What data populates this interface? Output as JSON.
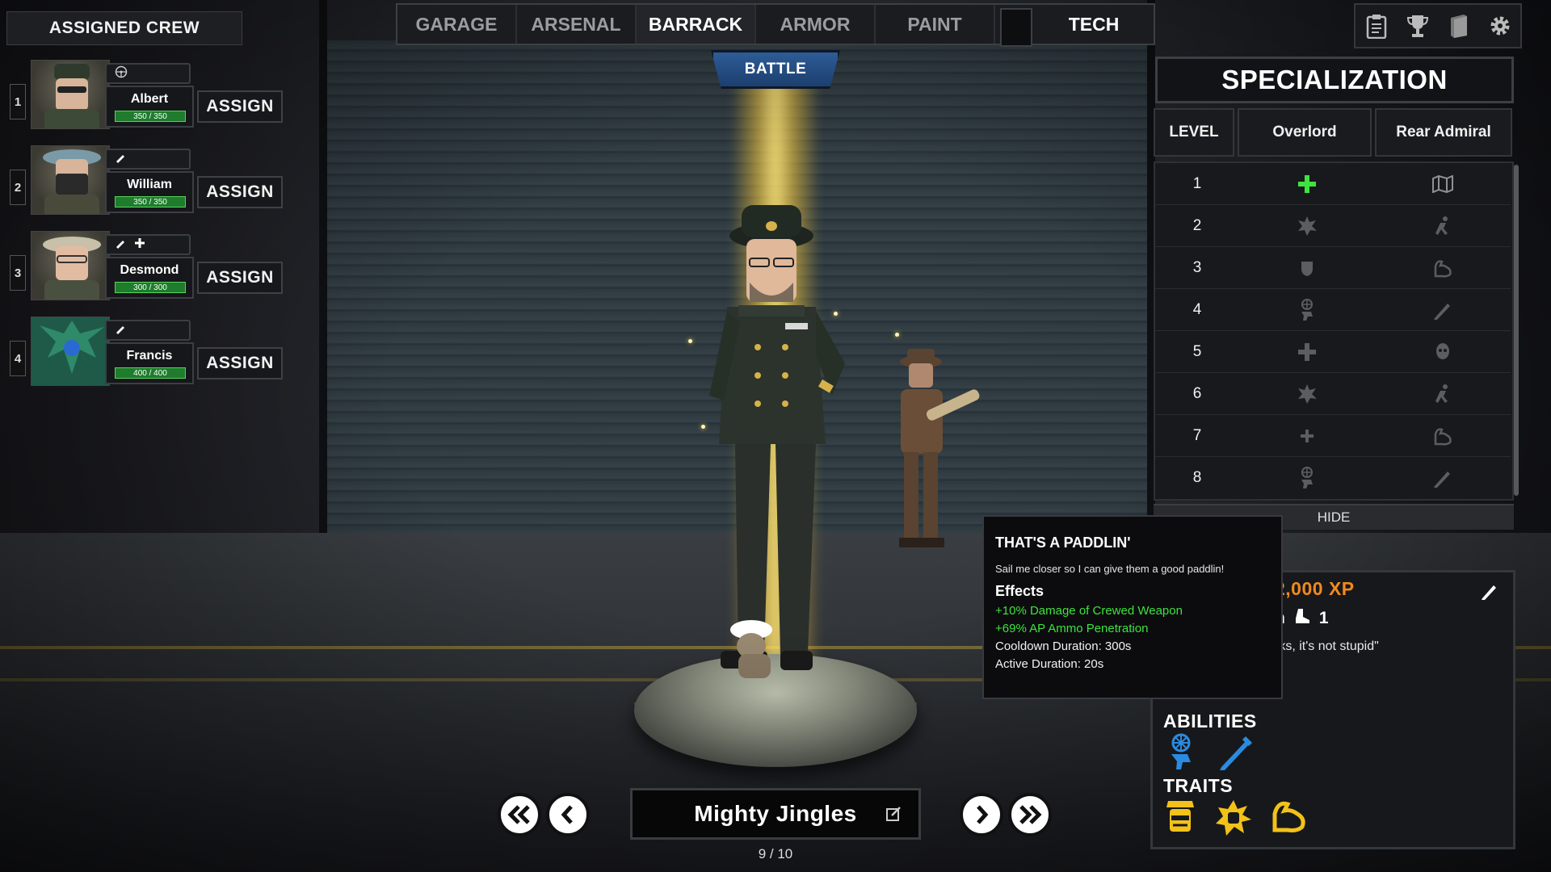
{
  "crew": {
    "header": "ASSIGNED CREW",
    "members": [
      {
        "num": "1",
        "name": "Albert",
        "hp": "350 / 350",
        "assign": "ASSIGN",
        "badges": [
          "steering-wheel-icon"
        ]
      },
      {
        "num": "2",
        "name": "William",
        "hp": "350 / 350",
        "assign": "ASSIGN",
        "badges": [
          "pencil-icon"
        ]
      },
      {
        "num": "3",
        "name": "Desmond",
        "hp": "300 / 300",
        "assign": "ASSIGN",
        "badges": [
          "pencil-icon",
          "plus-icon"
        ]
      },
      {
        "num": "4",
        "name": "Francis",
        "hp": "400 / 400",
        "assign": "ASSIGN",
        "badges": [
          "pencil-icon"
        ]
      }
    ]
  },
  "nav": {
    "tabs": [
      "GARAGE",
      "ARSENAL",
      "BARRACK",
      "ARMOR",
      "PAINT",
      "TECH"
    ],
    "active": "BARRACK",
    "battle": "BATTLE"
  },
  "top_icons": [
    "clipboard-icon",
    "trophy-icon",
    "book-icon",
    "gear-icon"
  ],
  "specialization": {
    "title": "SPECIALIZATION",
    "columns": [
      "LEVEL",
      "Overlord",
      "Rear Admiral"
    ],
    "rows": [
      {
        "level": "1",
        "overlord": "plus-icon",
        "admiral": "map-icon"
      },
      {
        "level": "2",
        "overlord": "burst-icon",
        "admiral": "runner-icon"
      },
      {
        "level": "3",
        "overlord": "shield-icon",
        "admiral": "bicep-icon"
      },
      {
        "level": "4",
        "overlord": "crouch-icon",
        "admiral": "pencil-icon"
      },
      {
        "level": "5",
        "overlord": "plus-icon",
        "admiral": "mask-icon"
      },
      {
        "level": "6",
        "overlord": "burst-icon",
        "admiral": "runner-icon"
      },
      {
        "level": "7",
        "overlord": "small-plus-icon",
        "admiral": "bicep-icon"
      },
      {
        "level": "8",
        "overlord": "crouch-icon",
        "admiral": "pencil-icon"
      }
    ],
    "hide": "HIDE"
  },
  "info": {
    "xp": "2,000 XP",
    "rank_prefix": "n",
    "rank_value": "1",
    "quote": "rks, it's not stupid\"",
    "abilities_label": "ABILITIES",
    "traits_label": "TRAITS",
    "abilities": [
      "crouch-ability-icon",
      "pencil-ability-icon"
    ],
    "traits": [
      "officer-trait-icon",
      "fist-burst-trait-icon",
      "bicep-trait-icon"
    ]
  },
  "tooltip": {
    "title": "THAT'S A PADDLIN'",
    "description": "Sail me closer so I can give them a good paddlin!",
    "effects_label": "Effects",
    "effects": [
      {
        "text": "+10% Damage of Crewed Weapon",
        "color": "#3fe23f"
      },
      {
        "text": "+69% AP Ammo Penetration",
        "color": "#3fe23f"
      },
      {
        "text": "Cooldown Duration: 300s",
        "color": "#f2f2f2"
      },
      {
        "text": "Active Duration: 20s",
        "color": "#f2f2f2"
      }
    ]
  },
  "character": {
    "name": "Mighty Jingles",
    "page": "9 / 10"
  },
  "colors": {
    "accent_green": "#3fe23f",
    "xp_orange": "#f08a1e",
    "trait_yellow": "#f2c218",
    "ability_blue": "#2a8be0",
    "battle_blue": "#2d5c95"
  }
}
